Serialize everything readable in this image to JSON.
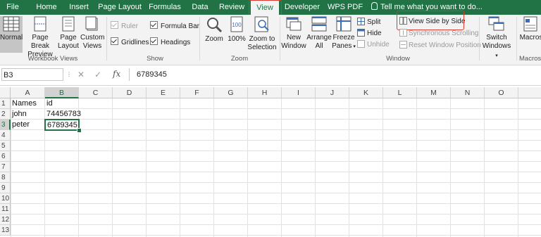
{
  "tabs": [
    "File",
    "Home",
    "Insert",
    "Page Layout",
    "Formulas",
    "Data",
    "Review",
    "View",
    "Developer",
    "WPS PDF"
  ],
  "active_tab": "View",
  "tell_me": "Tell me what you want to do...",
  "ribbon": {
    "workbook_views": {
      "label": "Workbook Views",
      "normal": "Normal",
      "page_break_1": "Page Break",
      "page_break_2": "Preview",
      "page_layout_1": "Page",
      "page_layout_2": "Layout",
      "custom_views_1": "Custom",
      "custom_views_2": "Views"
    },
    "show": {
      "label": "Show",
      "ruler": "Ruler",
      "formula_bar": "Formula Bar",
      "gridlines": "Gridlines",
      "headings": "Headings"
    },
    "zoom": {
      "label": "Zoom",
      "zoom": "Zoom",
      "hundred": "100%",
      "zoom_sel_1": "Zoom to",
      "zoom_sel_2": "Selection"
    },
    "window": {
      "label": "Window",
      "new_window_1": "New",
      "new_window_2": "Window",
      "arrange_all_1": "Arrange",
      "arrange_all_2": "All",
      "freeze_1": "Freeze",
      "freeze_2": "Panes",
      "split": "Split",
      "hide": "Hide",
      "unhide": "Unhide",
      "side_by_side": "View Side by Side",
      "sync_scroll": "Synchronous Scrolling",
      "reset_pos": "Reset Window Position",
      "switch_1": "Switch",
      "switch_2": "Windows"
    },
    "macros": {
      "label": "Macros",
      "button": "Macros"
    }
  },
  "formula_bar": {
    "name_box": "B3",
    "fx": "fx",
    "value": "6789345"
  },
  "columns": [
    "A",
    "B",
    "C",
    "D",
    "E",
    "F",
    "G",
    "H",
    "I",
    "J",
    "K",
    "L",
    "M",
    "N",
    "O"
  ],
  "rows": [
    "1",
    "2",
    "3",
    "4",
    "5",
    "6",
    "7",
    "8",
    "9",
    "10",
    "11",
    "12",
    "13"
  ],
  "cells": {
    "a1": "Names",
    "b1": "id",
    "a2": "john",
    "b2": "74456783",
    "a3": "peter",
    "b3": "6789345"
  },
  "accent_color": "#217346",
  "highlight_color": "#d9392f"
}
